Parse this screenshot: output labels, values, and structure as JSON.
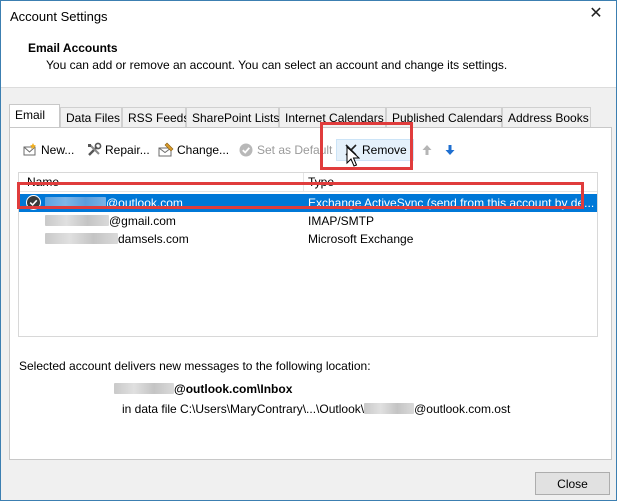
{
  "window": {
    "title": "Account Settings"
  },
  "header": {
    "title": "Email Accounts",
    "description": "You can add or remove an account. You can select an account and change its settings."
  },
  "tabs": [
    {
      "label": "Email",
      "active": true
    },
    {
      "label": "Data Files"
    },
    {
      "label": "RSS Feeds"
    },
    {
      "label": "SharePoint Lists"
    },
    {
      "label": "Internet Calendars"
    },
    {
      "label": "Published Calendars"
    },
    {
      "label": "Address Books"
    }
  ],
  "toolbar": {
    "new_label": "New...",
    "repair_label": "Repair...",
    "change_label": "Change...",
    "set_default_label": "Set as Default",
    "remove_label": "Remove"
  },
  "list": {
    "col_name": "Name",
    "col_type": "Type",
    "rows": [
      {
        "name_suffix": "@outlook.com",
        "type": "Exchange ActiveSync (send from this account by de..."
      },
      {
        "name_suffix": "@gmail.com",
        "type": "IMAP/SMTP"
      },
      {
        "name_suffix": "damsels.com",
        "type": "Microsoft Exchange"
      }
    ]
  },
  "delivery": {
    "label": "Selected account delivers new messages to the following location:",
    "path_suffix": "@outlook.com\\Inbox",
    "file_prefix": "in data file C:\\Users\\MaryContrary\\...\\Outlook\\",
    "file_suffix": "@outlook.com.ost"
  },
  "footer": {
    "close_label": "Close"
  },
  "colors": {
    "selection": "#0078d7",
    "highlight": "#e03c3c",
    "accent_blue": "#1e6fd0"
  }
}
